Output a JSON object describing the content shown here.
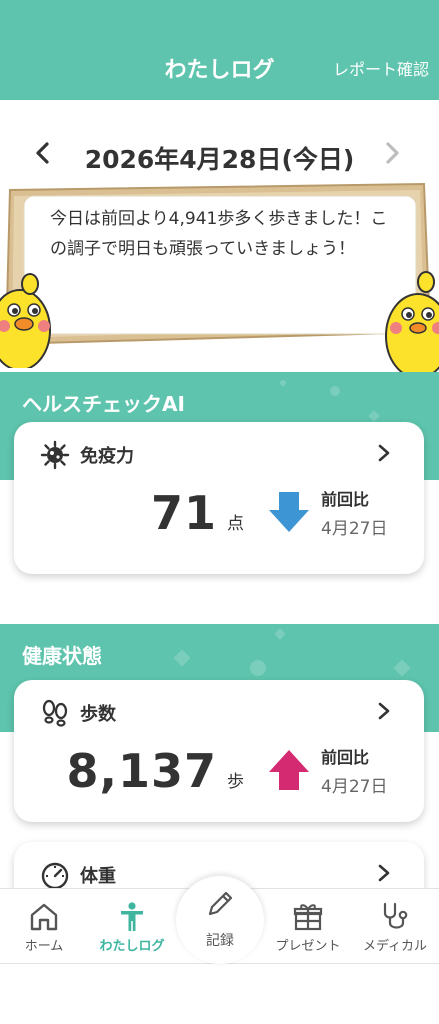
{
  "header": {
    "title": "わたしログ",
    "action_label": "レポート確認"
  },
  "date_nav": {
    "date_label": "2026年4月28日(今日)"
  },
  "message": {
    "text": "今日は前回より4,941歩多く歩きました！この調子で明日も頑張っていきましょう！"
  },
  "sections": {
    "health_check_ai": {
      "title": "ヘルスチェックAI"
    },
    "health_status": {
      "title": "健康状態"
    }
  },
  "cards": {
    "immunity": {
      "label": "免疫力",
      "value": "71",
      "unit": "点",
      "trend_title": "前回比",
      "trend_date": "4月27日",
      "trend": "down",
      "trend_color": "#3d95d3"
    },
    "steps": {
      "label": "歩数",
      "value": "8,137",
      "unit": "歩",
      "trend_title": "前回比",
      "trend_date": "4月27日",
      "trend": "up",
      "trend_color": "#d32a72"
    },
    "weight": {
      "label": "体重"
    }
  },
  "bottom_nav": {
    "home": "ホーム",
    "log": "わたしログ",
    "record": "記録",
    "present": "プレゼント",
    "medical": "メディカル"
  },
  "colors": {
    "primary": "#5ec4ad",
    "active": "#3fb5a0"
  }
}
